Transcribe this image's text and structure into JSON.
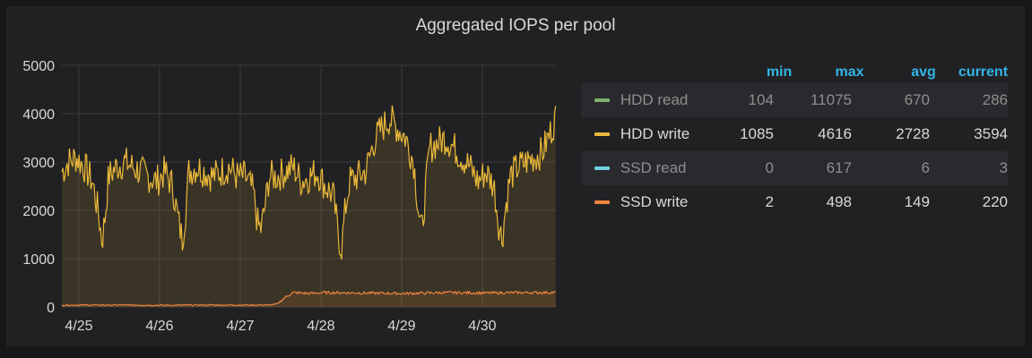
{
  "panel": {
    "title": "Aggregated IOPS per pool"
  },
  "legend": {
    "headers": {
      "min": "min",
      "max": "max",
      "avg": "avg",
      "current": "current"
    },
    "rows": [
      {
        "name": "HDD read",
        "color": "#7eb26d",
        "min": "104",
        "max": "11075",
        "avg": "670",
        "current": "286"
      },
      {
        "name": "HDD write",
        "color": "#eab839",
        "min": "1085",
        "max": "4616",
        "avg": "2728",
        "current": "3594"
      },
      {
        "name": "SSD read",
        "color": "#6ed0e0",
        "min": "0",
        "max": "617",
        "avg": "6",
        "current": "3"
      },
      {
        "name": "SSD write",
        "color": "#ef843c",
        "min": "2",
        "max": "498",
        "avg": "149",
        "current": "220"
      }
    ]
  },
  "chart_data": {
    "type": "line",
    "title": "Aggregated IOPS per pool",
    "xlabel": "",
    "ylabel": "",
    "ylim": [
      0,
      5000
    ],
    "yticks": [
      "0",
      "1000",
      "2000",
      "3000",
      "4000",
      "5000"
    ],
    "xlim": [
      0,
      6.15
    ],
    "xticks": [
      {
        "x": 0,
        "label": "4/25"
      },
      {
        "x": 1,
        "label": "4/26"
      },
      {
        "x": 2,
        "label": "4/27"
      },
      {
        "x": 3,
        "label": "4/28"
      },
      {
        "x": 4,
        "label": "4/29"
      },
      {
        "x": 5,
        "label": "4/30"
      }
    ],
    "grid": true,
    "series": [
      {
        "name": "HDD write",
        "color": "#eab839",
        "fill": true,
        "x": [
          -0.28,
          -0.2,
          -0.1,
          0,
          0.1,
          0.18,
          0.22,
          0.26,
          0.3,
          0.4,
          0.5,
          0.6,
          0.7,
          0.8,
          0.9,
          1,
          1.1,
          1.18,
          1.22,
          1.26,
          1.3,
          1.4,
          1.5,
          1.6,
          1.7,
          1.8,
          1.9,
          2,
          2.1,
          2.16,
          2.2,
          2.26,
          2.3,
          2.4,
          2.5,
          2.6,
          2.7,
          2.8,
          2.9,
          3,
          3.1,
          3.16,
          3.2,
          3.24,
          3.3,
          3.4,
          3.5,
          3.6,
          3.7,
          3.8,
          3.9,
          4,
          4.1,
          4.16,
          4.2,
          4.24,
          4.3,
          4.4,
          4.5,
          4.6,
          4.7,
          4.8,
          4.9,
          5,
          5.1,
          5.16,
          5.2,
          5.24,
          5.3,
          5.4,
          5.5,
          5.6,
          5.7,
          5.8,
          5.86
        ],
        "values": [
          2800,
          3000,
          3100,
          2900,
          2600,
          1900,
          1350,
          1900,
          2700,
          2900,
          3000,
          2900,
          2800,
          2700,
          2600,
          2800,
          2500,
          1700,
          1400,
          2000,
          2800,
          2900,
          2800,
          2700,
          2800,
          2900,
          2700,
          2700,
          2400,
          1700,
          1600,
          2200,
          2700,
          2700,
          2800,
          2900,
          2600,
          2700,
          2800,
          2500,
          2300,
          1500,
          1200,
          1900,
          2600,
          2700,
          2800,
          3400,
          3700,
          3900,
          3700,
          3500,
          3000,
          2000,
          1500,
          2300,
          3300,
          3400,
          3500,
          3300,
          3100,
          2900,
          2600,
          2800,
          2500,
          1700,
          1400,
          2000,
          2700,
          2900,
          3000,
          3100,
          3200,
          3600,
          3900
        ]
      },
      {
        "name": "SSD write",
        "color": "#ef843c",
        "fill": true,
        "x": [
          -0.28,
          0,
          0.5,
          1,
          1.5,
          2,
          2.3,
          2.4,
          2.5,
          2.6,
          2.8,
          3,
          3.5,
          4,
          4.5,
          5,
          5.5,
          5.86
        ],
        "values": [
          40,
          40,
          40,
          35,
          40,
          40,
          40,
          60,
          200,
          300,
          280,
          300,
          290,
          280,
          300,
          290,
          300,
          300
        ]
      }
    ]
  }
}
